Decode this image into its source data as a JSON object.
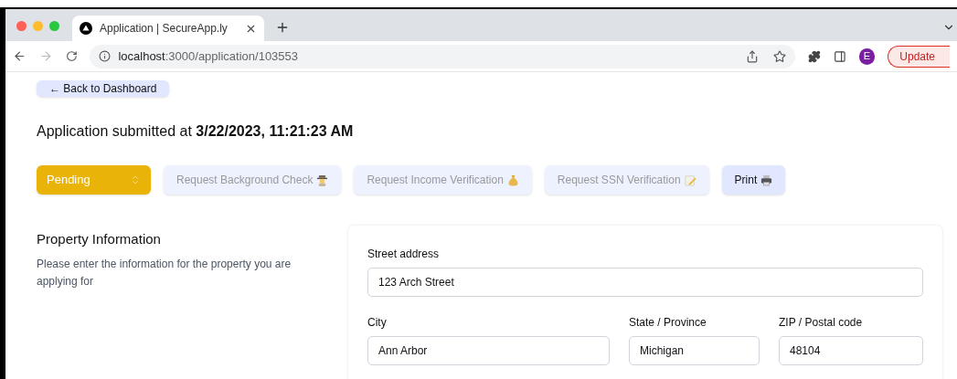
{
  "browser": {
    "tab_title": "Application | SecureApp.ly",
    "url_host": "localhost",
    "url_path": ":3000/application/103553",
    "profile_initial": "E",
    "update_label": "Update"
  },
  "back_button": "← Back to Dashboard",
  "submitted": "Application submitted at **3/22/2023, 11:21:23 AM**",
  "status_select": {
    "value": "Pending"
  },
  "actions": [
    {
      "label": "Request Background Check",
      "kind": "detective",
      "disabled": true
    },
    {
      "label": "Request Income Verification",
      "kind": "moneybag",
      "disabled": true
    },
    {
      "label": "Request SSN Verification",
      "kind": "memo",
      "disabled": true
    },
    {
      "label": "Print",
      "kind": "printer",
      "disabled": false
    }
  ],
  "section": {
    "title": "Property Information",
    "description": "Please enter the information for the property you are applying for"
  },
  "field_rows": [
    [
      {
        "label": "Street address",
        "value": "123 Arch Street"
      }
    ],
    [
      {
        "label": "City",
        "value": "Ann Arbor"
      },
      {
        "label": "State / Province",
        "value": "Michigan"
      },
      {
        "label": "ZIP / Postal code",
        "value": "48104"
      }
    ]
  ]
}
